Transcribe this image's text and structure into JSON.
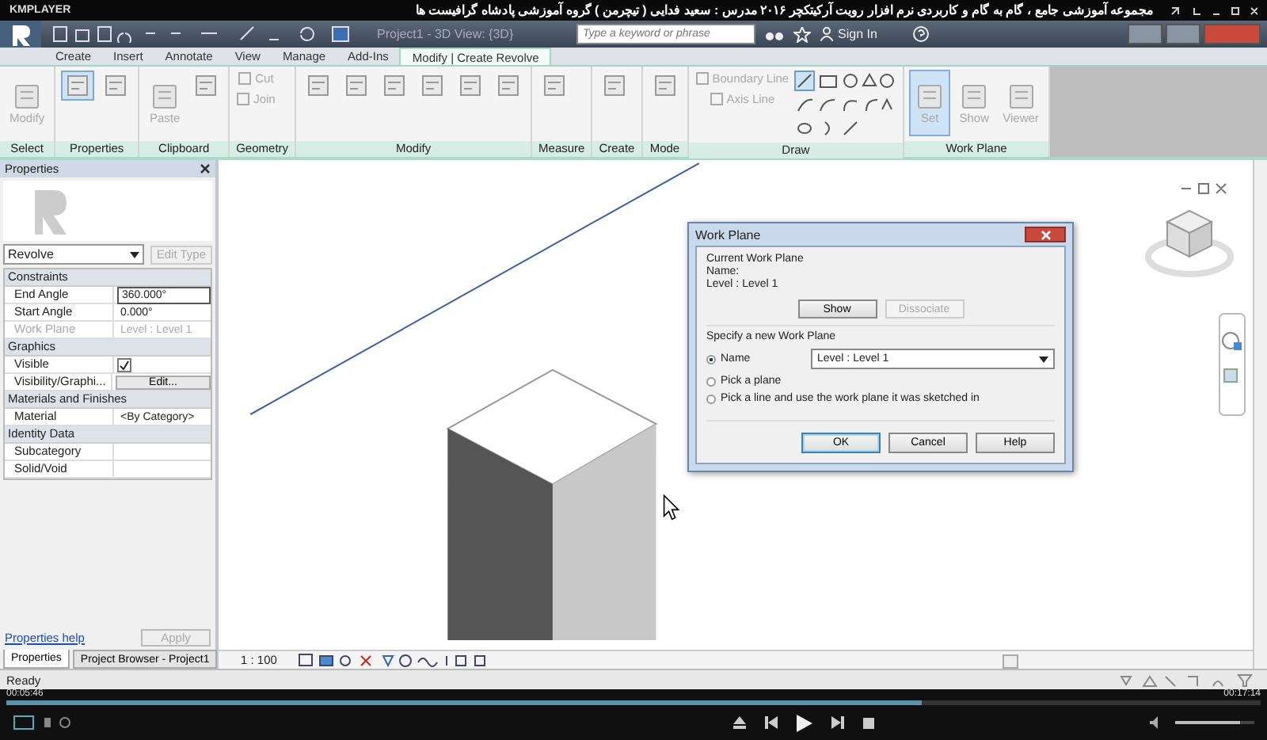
{
  "player": {
    "name": "KMPLAYER",
    "title": "مجموعه آموزشی جامع ، گام به گام و کاربردی نرم افزار رویت آرکیتکچر ۲۰۱۶   مدرس : سعید فدایی ( تیچرمن ) گروه آموزشی پادشاه گرافیست ها",
    "time_elapsed": "00:05:46",
    "time_total": "00:17:14",
    "progress": {
      "level": 0.73
    },
    "volume": {
      "level": 0.82
    }
  },
  "app": {
    "doc_title": "Project1 - 3D View: {3D}",
    "search": {
      "placeholder": "Type a keyword or phrase"
    },
    "sign_in": "Sign In"
  },
  "tabs": [
    {
      "label": "Create",
      "selected": false
    },
    {
      "label": "Insert",
      "selected": false
    },
    {
      "label": "Annotate",
      "selected": false
    },
    {
      "label": "View",
      "selected": false
    },
    {
      "label": "Manage",
      "selected": false
    },
    {
      "label": "Add-Ins",
      "selected": false
    },
    {
      "label": "Modify | Create Revolve",
      "selected": true
    }
  ],
  "ribbon": [
    {
      "label": "Select",
      "tools": [
        {
          "kind": "large",
          "label": "Modify",
          "disabled": true,
          "selected": false
        }
      ]
    },
    {
      "label": "Properties",
      "tools": [
        {
          "kind": "icon",
          "selected": true
        },
        {
          "kind": "icon",
          "selected": false
        }
      ]
    },
    {
      "label": "Clipboard",
      "tools": [
        {
          "kind": "large",
          "label": "Paste",
          "disabled": true,
          "selected": false
        },
        {
          "kind": "icon",
          "selected": false
        }
      ]
    },
    {
      "label": "Geometry",
      "tools": [
        {
          "kind": "small",
          "label": "Cut",
          "disabled": true
        },
        {
          "kind": "small",
          "label": "Join",
          "disabled": true
        }
      ]
    },
    {
      "label": "Modify",
      "tools": [
        {
          "kind": "icon",
          "selected": false
        },
        {
          "kind": "icon",
          "selected": false
        },
        {
          "kind": "icon",
          "selected": false
        },
        {
          "kind": "icon",
          "selected": false
        },
        {
          "kind": "icon",
          "selected": false
        },
        {
          "kind": "icon",
          "selected": false
        }
      ]
    },
    {
      "label": "Measure",
      "tools": [
        {
          "kind": "icon",
          "selected": false
        }
      ]
    },
    {
      "label": "Create",
      "tools": [
        {
          "kind": "icon",
          "selected": false
        }
      ]
    },
    {
      "label": "Mode",
      "tools": [
        {
          "kind": "icon",
          "selected": false
        }
      ]
    },
    {
      "label": "Draw",
      "tools": [
        {
          "kind": "small",
          "label": "Boundary Line",
          "disabled": true
        },
        {
          "kind": "small",
          "label": "Axis Line",
          "disabled": true
        },
        {
          "kind": "gallery"
        }
      ]
    },
    {
      "label": "Work Plane",
      "tools": [
        {
          "kind": "large",
          "label": "Set",
          "disabled": true,
          "selected": true
        },
        {
          "kind": "large",
          "label": "Show",
          "disabled": true,
          "selected": false
        },
        {
          "kind": "large",
          "label": "Viewer",
          "disabled": true,
          "selected": false
        }
      ]
    }
  ],
  "properties": {
    "title": "Properties",
    "type": "Revolve",
    "edit_type": {
      "label": "Edit Type",
      "disabled": true
    },
    "rows": [
      {
        "kind": "group",
        "label": "Constraints"
      },
      {
        "kind": "field",
        "label": "End Angle",
        "value": "360.000°",
        "disabled": false
      },
      {
        "kind": "field",
        "label": "Start Angle",
        "value": "0.000°",
        "disabled": false
      },
      {
        "kind": "field",
        "label": "Work Plane",
        "value": "Level : Level 1",
        "disabled": true
      },
      {
        "kind": "group",
        "label": "Graphics"
      },
      {
        "kind": "checkbox",
        "label": "Visible",
        "checked": true
      },
      {
        "kind": "button",
        "label": "Visibility/Graphi...",
        "value": "Edit..."
      },
      {
        "kind": "group",
        "label": "Materials and Finishes"
      },
      {
        "kind": "field",
        "label": "Material",
        "value": "<By Category>",
        "disabled": false
      },
      {
        "kind": "group",
        "label": "Identity Data"
      },
      {
        "kind": "field",
        "label": "Subcategory",
        "disabled": false
      },
      {
        "kind": "field",
        "label": "Solid/Void",
        "disabled": false
      }
    ],
    "help": "Properties help",
    "apply": {
      "label": "Apply",
      "disabled": true
    },
    "tabs": [
      {
        "label": "Properties",
        "selected": true
      },
      {
        "label": "Project Browser - Project1",
        "selected": false
      }
    ]
  },
  "view": {
    "scale": "1 : 100"
  },
  "dialog": {
    "title": "Work Plane",
    "current_heading": "Current Work Plane",
    "name_label": "Name:",
    "name_value": "Level : Level 1",
    "buttons": [
      {
        "label": "Show",
        "disabled": false
      },
      {
        "label": "Dissociate",
        "disabled": true
      }
    ],
    "specify_heading": "Specify a new Work Plane",
    "options": [
      {
        "label": "Name",
        "selected": true,
        "dropdown": "Level : Level 1"
      },
      {
        "label": "Pick a plane",
        "selected": false
      },
      {
        "label": "Pick a line and use the work plane it was sketched in",
        "selected": false
      }
    ],
    "footer": [
      {
        "label": "OK",
        "default": true
      },
      {
        "label": "Cancel",
        "default": false
      },
      {
        "label": "Help",
        "default": false
      }
    ]
  },
  "status": "Ready"
}
